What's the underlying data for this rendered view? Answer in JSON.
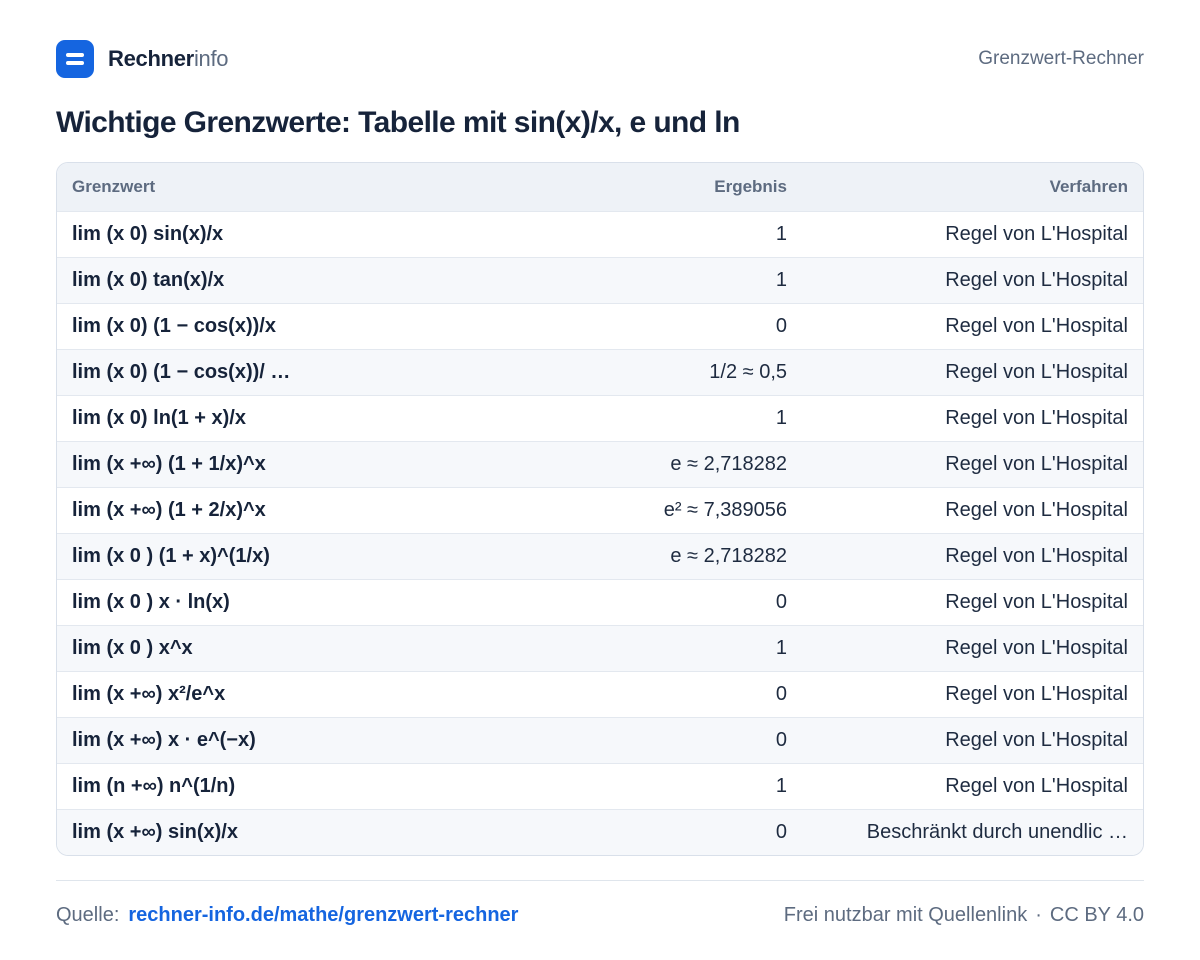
{
  "header": {
    "brand_strong": "Rechner",
    "brand_light": "info",
    "page_label": "Grenzwert-Rechner"
  },
  "title": "Wichtige Grenzwerte: Tabelle mit sin(x)/x, e und ln",
  "table": {
    "columns": [
      "Grenzwert",
      "Ergebnis",
      "Verfahren"
    ],
    "rows": [
      {
        "limit": "lim (x   0) sin(x)/x",
        "result": "1",
        "method": "Regel von L'Hospital"
      },
      {
        "limit": "lim (x   0) tan(x)/x",
        "result": "1",
        "method": "Regel von L'Hospital"
      },
      {
        "limit": "lim (x   0) (1 − cos(x))/x",
        "result": "0",
        "method": "Regel von L'Hospital"
      },
      {
        "limit": "lim (x   0) (1 − cos(x))/ …",
        "result": "1/2 ≈ 0,5",
        "method": "Regel von L'Hospital"
      },
      {
        "limit": "lim (x   0) ln(1 + x)/x",
        "result": "1",
        "method": "Regel von L'Hospital"
      },
      {
        "limit": "lim (x   +∞) (1 + 1/x)^x",
        "result": "e ≈ 2,718282",
        "method": "Regel von L'Hospital"
      },
      {
        "limit": "lim (x   +∞) (1 + 2/x)^x",
        "result": "e² ≈ 7,389056",
        "method": "Regel von L'Hospital"
      },
      {
        "limit": "lim (x   0 ) (1 + x)^(1/x)",
        "result": "e ≈ 2,718282",
        "method": "Regel von L'Hospital"
      },
      {
        "limit": "lim (x   0 ) x · ln(x)",
        "result": "0",
        "method": "Regel von L'Hospital"
      },
      {
        "limit": "lim (x   0 ) x^x",
        "result": "1",
        "method": "Regel von L'Hospital"
      },
      {
        "limit": "lim (x   +∞) x²/e^x",
        "result": "0",
        "method": "Regel von L'Hospital"
      },
      {
        "limit": "lim (x   +∞) x · e^(−x)",
        "result": "0",
        "method": "Regel von L'Hospital"
      },
      {
        "limit": "lim (n   +∞) n^(1/n)",
        "result": "1",
        "method": "Regel von L'Hospital"
      },
      {
        "limit": "lim (x   +∞) sin(x)/x",
        "result": "0",
        "method": "Beschränkt durch unendlic …"
      }
    ]
  },
  "footer": {
    "source_label": "Quelle:",
    "source_link": "rechner-info.de/mathe/grenzwert-rechner",
    "license_text": "Frei nutzbar mit Quellenlink",
    "separator": "·",
    "license": "CC BY 4.0"
  },
  "colors": {
    "accent": "#1565e0",
    "text": "#16233a",
    "muted": "#5d6b80"
  }
}
